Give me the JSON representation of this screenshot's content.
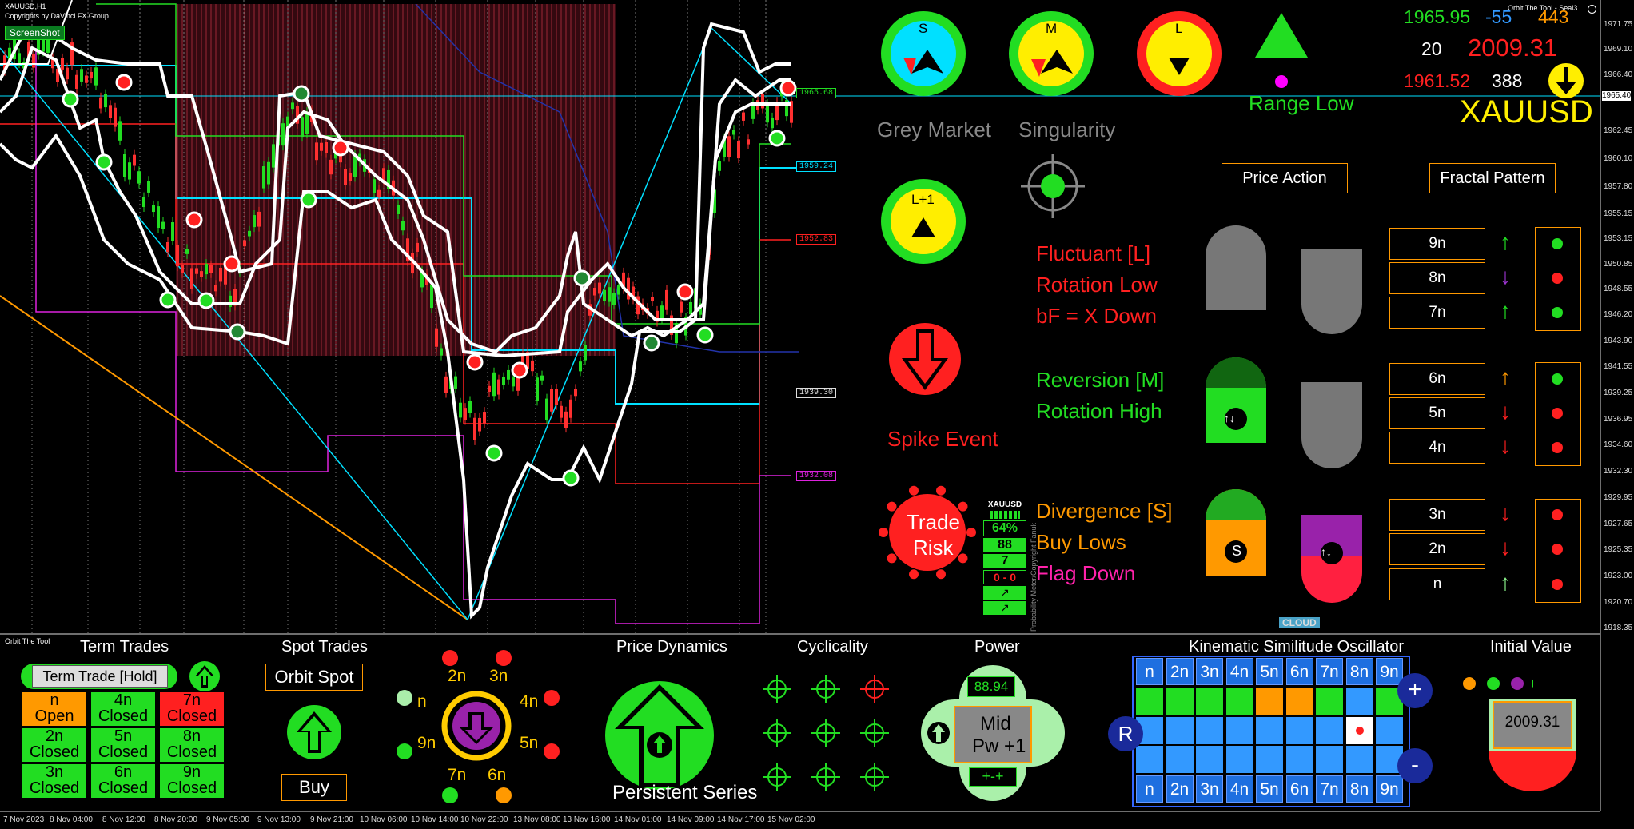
{
  "window": {
    "symbol_title": "XAUUSD,H1",
    "copyright": "Copyrights by DaVinci FX Group",
    "screenshot_button": "ScreenShot",
    "tool_title": "Orbit The Tool - Seal3"
  },
  "price_axis": [
    "1971.75",
    "1969.10",
    "1966.40",
    "1965.40",
    "1962.45",
    "1960.10",
    "1957.80",
    "1955.15",
    "1953.15",
    "1950.85",
    "1948.55",
    "1946.20",
    "1943.90",
    "1941.55",
    "1939.25",
    "1936.95",
    "1934.60",
    "1932.30",
    "1929.95",
    "1927.65",
    "1925.35",
    "1923.00",
    "1920.70",
    "1918.35"
  ],
  "time_axis": [
    "7 Nov 2023",
    "8 Nov 04:00",
    "8 Nov 12:00",
    "8 Nov 20:00",
    "9 Nov 05:00",
    "9 Nov 13:00",
    "9 Nov 21:00",
    "10 Nov 06:00",
    "10 Nov 14:00",
    "10 Nov 22:00",
    "13 Nov 08:00",
    "13 Nov 16:00",
    "14 Nov 01:00",
    "14 Nov 09:00",
    "14 Nov 17:00",
    "15 Nov 02:00"
  ],
  "level_tags": [
    "1965.68",
    "1959.24",
    "1952.83",
    "1939.30",
    "1932.08"
  ],
  "quote": {
    "price1": "1965.95",
    "change": "-55",
    "count": "443",
    "n20": "20",
    "high": "2009.31",
    "low": "1961.52",
    "n388": "388",
    "symbol": "XAUUSD"
  },
  "dials": {
    "s": "S",
    "m": "M",
    "l": "L",
    "l1": "L+1"
  },
  "labels": {
    "range_low": "Range Low",
    "grey_market": "Grey Market",
    "singularity": "Singularity",
    "spike_event": "Spike Event",
    "trade_risk_1": "Trade",
    "trade_risk_2": "Risk",
    "price_action": "Price Action",
    "fractal_pattern": "Fractal Pattern",
    "cloud": "CLOUD"
  },
  "states": {
    "l_lines": [
      "Fluctuant [L]",
      "Rotation Low",
      "bF = X Down"
    ],
    "m_lines": [
      "Reversion [M]",
      "Rotation High"
    ],
    "s_lines": [
      "Divergence [S]",
      "Buy Lows",
      "Flag Down"
    ]
  },
  "meter": {
    "title": "XAUUSD",
    "pct": "64%",
    "v1": "88",
    "v2": "7",
    "v3": "0 - 0",
    "side": "Probability Meter/Copyright Fanuk"
  },
  "fractal_rows": [
    {
      "label": "9n",
      "arrow": "↑",
      "arrow_color": "#22dd22",
      "dot": "#22dd22"
    },
    {
      "label": "8n",
      "arrow": "↓",
      "arrow_color": "#9933cc",
      "dot": "#ff2020"
    },
    {
      "label": "7n",
      "arrow": "↑",
      "arrow_color": "#22dd22",
      "dot": "#22dd22"
    },
    {
      "label": "6n",
      "arrow": "↑",
      "arrow_color": "#ff9900",
      "dot": "#22dd22"
    },
    {
      "label": "5n",
      "arrow": "↓",
      "arrow_color": "#ff2020",
      "dot": "#ff2020"
    },
    {
      "label": "4n",
      "arrow": "↓",
      "arrow_color": "#ff2020",
      "dot": "#ff2020"
    },
    {
      "label": "3n",
      "arrow": "↓",
      "arrow_color": "#ff2020",
      "dot": "#ff2020"
    },
    {
      "label": "2n",
      "arrow": "↓",
      "arrow_color": "#ff2020",
      "dot": "#ff2020"
    },
    {
      "label": "n",
      "arrow": "↑",
      "arrow_color": "#88ee88",
      "dot": "#ff2020"
    }
  ],
  "bottom": {
    "panel_title": "Orbit The Tool",
    "term_trades": "Term Trades",
    "term_trade_hold": "Term Trade [Hold]",
    "spot_trades": "Spot Trades",
    "orbit_spot": "Orbit Spot",
    "buy": "Buy",
    "price_dynamics": "Price Dynamics",
    "persistent_series": "Persistent Series",
    "cyclicality": "Cyclicality",
    "power": "Power",
    "power_value": "88.94",
    "power_mid": "Mid",
    "power_pw": "Pw +1",
    "kso": "Kinematic Similitude Oscillator",
    "initial_value": "Initial Value",
    "initial_value_num": "2009.31",
    "kso_r": "R",
    "kso_plus": "+",
    "kso_minus": "-"
  },
  "term_grid": [
    {
      "a": "n",
      "b": "Open",
      "color": "#ff9900"
    },
    {
      "a": "4n",
      "b": "Closed",
      "color": "#22dd22"
    },
    {
      "a": "7n",
      "b": "Closed",
      "color": "#ff2020"
    },
    {
      "a": "2n",
      "b": "Closed",
      "color": "#22dd22"
    },
    {
      "a": "5n",
      "b": "Closed",
      "color": "#22dd22"
    },
    {
      "a": "8n",
      "b": "Closed",
      "color": "#22dd22"
    },
    {
      "a": "3n",
      "b": "Closed",
      "color": "#22dd22"
    },
    {
      "a": "6n",
      "b": "Closed",
      "color": "#22dd22"
    },
    {
      "a": "9n",
      "b": "Closed",
      "color": "#22dd22"
    }
  ],
  "orbit_labels": [
    "2n",
    "3n",
    "4n",
    "5n",
    "6n",
    "7n",
    "9n",
    "n"
  ],
  "kso_headers": [
    "n",
    "2n",
    "3n",
    "4n",
    "5n",
    "6n",
    "7n",
    "8n",
    "9n"
  ],
  "kso_row1": [
    "#22dd22",
    "#22dd22",
    "#22dd22",
    "#22dd22",
    "#ff9900",
    "#ff9900",
    "#22dd22",
    "#3399ff",
    "#22dd22"
  ]
}
